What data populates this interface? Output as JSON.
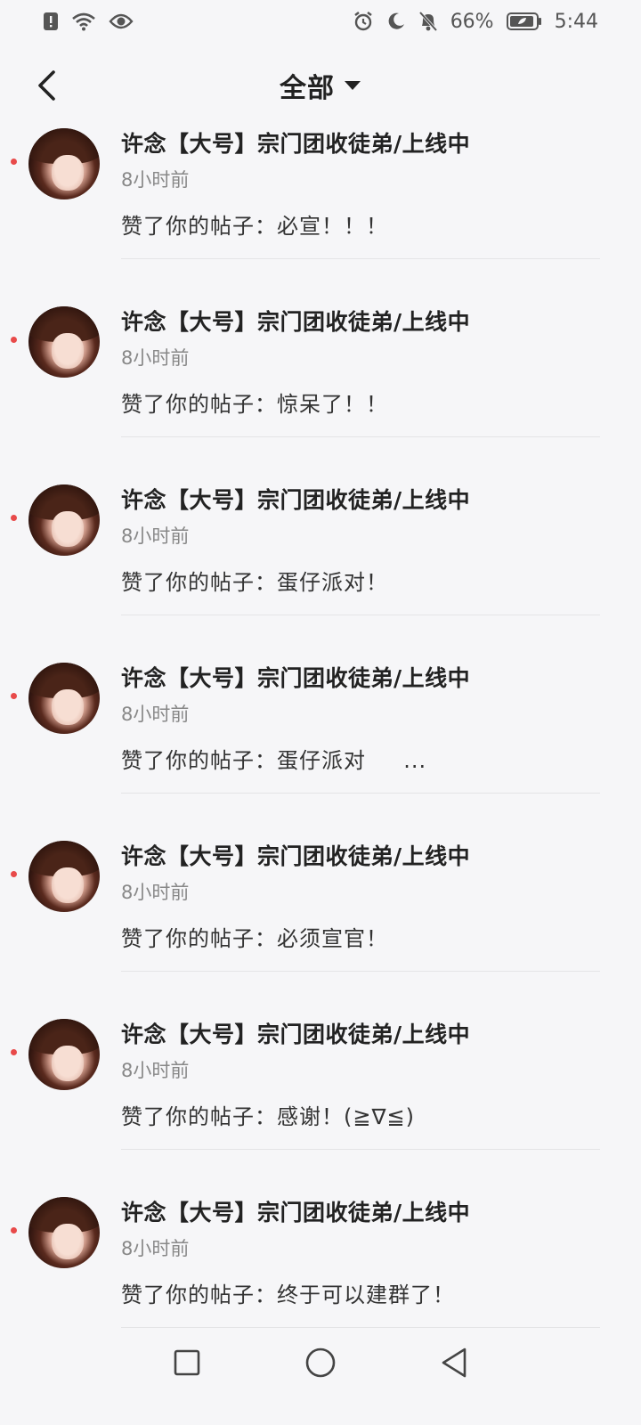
{
  "status_bar": {
    "battery_percent": "66%",
    "time": "5:44",
    "icons": [
      "alert-icon",
      "wifi-icon",
      "eye-icon",
      "alarm-icon",
      "moon-icon",
      "bell-off-icon",
      "battery-icon"
    ]
  },
  "header": {
    "title": "全部"
  },
  "notifications": [
    {
      "username": "许念【大号】宗门团收徒弟/上线中",
      "time": "8小时前",
      "content": "赞了你的帖子：必宣！！！",
      "unread": true
    },
    {
      "username": "许念【大号】宗门团收徒弟/上线中",
      "time": "8小时前",
      "content": "赞了你的帖子：惊呆了！！",
      "unread": true
    },
    {
      "username": "许念【大号】宗门团收徒弟/上线中",
      "time": "8小时前",
      "content": "赞了你的帖子：蛋仔派对！",
      "unread": true
    },
    {
      "username": "许念【大号】宗门团收徒弟/上线中",
      "time": "8小时前",
      "content": "赞了你的帖子：蛋仔派对 　 ...",
      "unread": true
    },
    {
      "username": "许念【大号】宗门团收徒弟/上线中",
      "time": "8小时前",
      "content": "赞了你的帖子：必须宣官！",
      "unread": true
    },
    {
      "username": "许念【大号】宗门团收徒弟/上线中",
      "time": "8小时前",
      "content": "赞了你的帖子：感谢！(≧∇≦)",
      "unread": true
    },
    {
      "username": "许念【大号】宗门团收徒弟/上线中",
      "time": "8小时前",
      "content": "赞了你的帖子：终于可以建群了！",
      "unread": true
    }
  ],
  "colors": {
    "background": "#f6f6f8",
    "unread_dot": "#e84a4a",
    "text_primary": "#222222",
    "text_secondary": "#888888"
  }
}
